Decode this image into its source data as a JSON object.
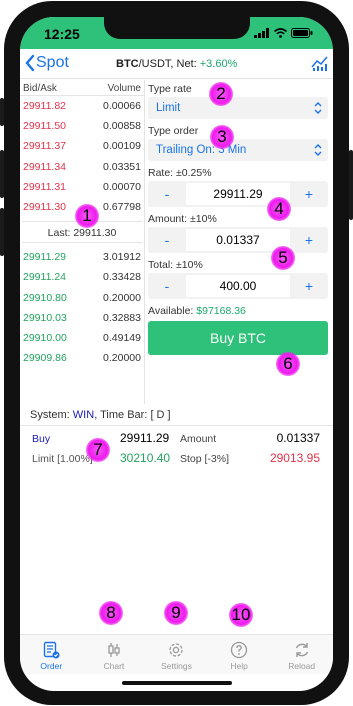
{
  "status": {
    "time": "12:25"
  },
  "nav": {
    "back_label": "Spot",
    "pair": "BTC",
    "quote": "/USDT, Net: ",
    "net": "+3.60%"
  },
  "book": {
    "header_left": "Bid/Ask",
    "header_right": "Volume",
    "asks": [
      {
        "price": "29911.82",
        "vol": "0.00066"
      },
      {
        "price": "29911.50",
        "vol": "0.00858"
      },
      {
        "price": "29911.37",
        "vol": "0.00109"
      },
      {
        "price": "29911.34",
        "vol": "0.03351"
      },
      {
        "price": "29911.31",
        "vol": "0.00070"
      },
      {
        "price": "29911.30",
        "vol": "0.67798"
      }
    ],
    "last": "Last: 29911.30",
    "bids": [
      {
        "price": "29911.29",
        "vol": "3.01912"
      },
      {
        "price": "29911.24",
        "vol": "0.33428"
      },
      {
        "price": "29910.80",
        "vol": "0.20000"
      },
      {
        "price": "29910.03",
        "vol": "0.32883"
      },
      {
        "price": "29910.00",
        "vol": "0.49149"
      },
      {
        "price": "29909.86",
        "vol": "0.20000"
      }
    ]
  },
  "form": {
    "type_rate_label": "Type rate",
    "type_rate_value": "Limit",
    "type_order_label": "Type order",
    "type_order_value": "Trailing On: 3 Min",
    "rate_label": "Rate: ±0.25%",
    "rate_value": "29911.29",
    "amount_label": "Amount: ±10%",
    "amount_value": "0.01337",
    "total_label": "Total: ±10%",
    "total_value": "400.00",
    "minus": "-",
    "plus": "+",
    "available_label": "Available: ",
    "available_value": "$97168.36",
    "buy_label": "Buy BTC"
  },
  "system": {
    "label": "System: ",
    "value": "WIN",
    "sep": ", Time Bar: ",
    "bar": "[ D ]"
  },
  "order": {
    "side": "Buy",
    "price": "29911.29",
    "amount_label": "Amount",
    "amount_value": "0.01337",
    "limit_label": "Limit [1.00%]",
    "limit_value": "30210.40",
    "stop_label": "Stop [-3%]",
    "stop_value": "29013.95"
  },
  "tabs": [
    {
      "label": "Order",
      "icon": "order-icon",
      "active": true
    },
    {
      "label": "Chart",
      "icon": "candles-icon",
      "active": false
    },
    {
      "label": "Settings",
      "icon": "gear-icon",
      "active": false
    },
    {
      "label": "Help",
      "icon": "help-icon",
      "active": false
    },
    {
      "label": "Reload",
      "icon": "reload-icon",
      "active": false
    }
  ],
  "markers": [
    "1",
    "2",
    "3",
    "4",
    "5",
    "6",
    "7",
    "8",
    "9",
    "10"
  ],
  "colors": {
    "accent": "#2ec17a",
    "link": "#1a73e8",
    "ask": "#e0324a",
    "bid": "#22a35e",
    "marker": "#ee1aee"
  }
}
